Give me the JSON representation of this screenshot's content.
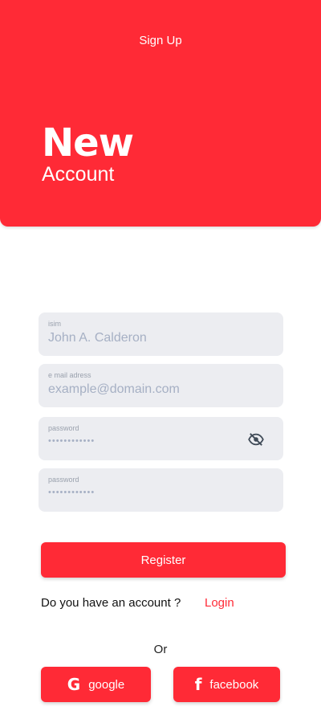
{
  "header": {
    "title": "Sign Up",
    "hero_line1": "New",
    "hero_line2": "Account"
  },
  "form": {
    "name": {
      "label": "isim",
      "value": "John A. Calderon"
    },
    "email": {
      "label": "e mail adress",
      "value": "example@domain.com"
    },
    "password": {
      "label": "password",
      "value": "••••••••••••",
      "icon": "eye-off-icon"
    },
    "password_confirm": {
      "label": "password",
      "value": "••••••••••••"
    }
  },
  "actions": {
    "register_label": "Register",
    "account_question": "Do you have an account ?",
    "login_label": "Login",
    "or_label": "Or"
  },
  "social": {
    "google_label": "google",
    "google_icon": "G",
    "facebook_label": "facebook",
    "facebook_icon": "f"
  },
  "colors": {
    "accent": "#ff2a36",
    "field_bg": "#ecedf1",
    "placeholder": "#a6b0c4"
  }
}
